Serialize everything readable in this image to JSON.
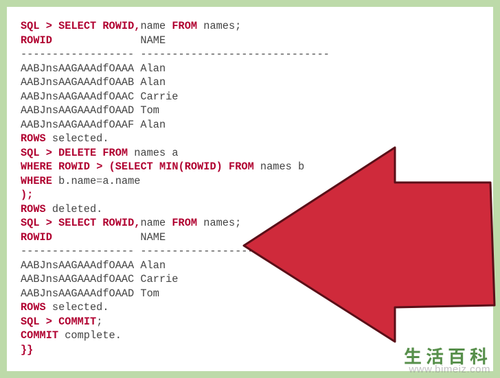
{
  "code_tokens": [
    [
      [
        "kw",
        "SQL"
      ],
      [
        "txt",
        " "
      ],
      [
        "p",
        ">"
      ],
      [
        "txt",
        " "
      ],
      [
        "kw",
        "SELECT"
      ],
      [
        "txt",
        " "
      ],
      [
        "kw",
        "ROWID"
      ],
      [
        "p",
        ","
      ],
      [
        "txt",
        "name "
      ],
      [
        "kw",
        "FROM"
      ],
      [
        "txt",
        " names;"
      ]
    ],
    [
      [
        "kw",
        "ROWID"
      ],
      [
        "txt",
        "              NAME"
      ]
    ],
    [
      [
        "txt",
        "------------------ ------------------------------"
      ]
    ],
    [
      [
        "txt",
        "AABJnsAAGAAAdfOAAA Alan"
      ]
    ],
    [
      [
        "txt",
        "AABJnsAAGAAAdfOAAB Alan"
      ]
    ],
    [
      [
        "txt",
        "AABJnsAAGAAAdfOAAC Carrie"
      ]
    ],
    [
      [
        "txt",
        "AABJnsAAGAAAdfOAAD Tom"
      ]
    ],
    [
      [
        "txt",
        "AABJnsAAGAAAdfOAAF Alan"
      ]
    ],
    [
      [
        "kw",
        "ROWS"
      ],
      [
        "txt",
        " selected."
      ]
    ],
    [
      [
        "kw",
        "SQL"
      ],
      [
        "txt",
        " "
      ],
      [
        "p",
        ">"
      ],
      [
        "txt",
        " "
      ],
      [
        "kw",
        "DELETE"
      ],
      [
        "txt",
        " "
      ],
      [
        "kw",
        "FROM"
      ],
      [
        "txt",
        " names a"
      ]
    ],
    [
      [
        "kw",
        "WHERE"
      ],
      [
        "txt",
        " "
      ],
      [
        "kw",
        "ROWID"
      ],
      [
        "txt",
        " "
      ],
      [
        "p",
        ">"
      ],
      [
        "txt",
        " "
      ],
      [
        "p",
        "("
      ],
      [
        "kw",
        "SELECT"
      ],
      [
        "txt",
        " "
      ],
      [
        "kw",
        "MIN"
      ],
      [
        "p",
        "("
      ],
      [
        "kw",
        "ROWID"
      ],
      [
        "p",
        ")"
      ],
      [
        "txt",
        " "
      ],
      [
        "kw",
        "FROM"
      ],
      [
        "txt",
        " names b"
      ]
    ],
    [
      [
        "kw",
        "WHERE"
      ],
      [
        "txt",
        " b.name"
      ],
      [
        "op",
        "="
      ],
      [
        "txt",
        "a.name"
      ]
    ],
    [
      [
        "p",
        ");"
      ]
    ],
    [
      [
        "kw",
        "ROWS"
      ],
      [
        "txt",
        " deleted."
      ]
    ],
    [
      [
        "kw",
        "SQL"
      ],
      [
        "txt",
        " "
      ],
      [
        "p",
        ">"
      ],
      [
        "txt",
        " "
      ],
      [
        "kw",
        "SELECT"
      ],
      [
        "txt",
        " "
      ],
      [
        "kw",
        "ROWID"
      ],
      [
        "p",
        ","
      ],
      [
        "txt",
        "name "
      ],
      [
        "kw",
        "FROM"
      ],
      [
        "txt",
        " names;"
      ]
    ],
    [
      [
        "kw",
        "ROWID"
      ],
      [
        "txt",
        "              NAME"
      ]
    ],
    [
      [
        "txt",
        "------------------ ----------------------"
      ]
    ],
    [
      [
        "txt",
        "AABJnsAAGAAAdfOAAA Alan"
      ]
    ],
    [
      [
        "txt",
        "AABJnsAAGAAAdfOAAC Carrie"
      ]
    ],
    [
      [
        "txt",
        "AABJnsAAGAAAdfOAAD Tom"
      ]
    ],
    [
      [
        "kw",
        "ROWS"
      ],
      [
        "txt",
        " selected."
      ]
    ],
    [
      [
        "kw",
        "SQL"
      ],
      [
        "txt",
        " "
      ],
      [
        "p",
        ">"
      ],
      [
        "txt",
        " "
      ],
      [
        "kw",
        "COMMIT"
      ],
      [
        "txt",
        ";"
      ]
    ],
    [
      [
        "kw",
        "COMMIT"
      ],
      [
        "txt",
        " complete."
      ]
    ],
    [
      [
        "p",
        "}}"
      ]
    ]
  ],
  "watermark": {
    "logo_text": "生活百科",
    "url": "www.bimeiz.com"
  },
  "arrow": {
    "fill": "#cf2a3b",
    "stroke": "#5a0f18"
  }
}
